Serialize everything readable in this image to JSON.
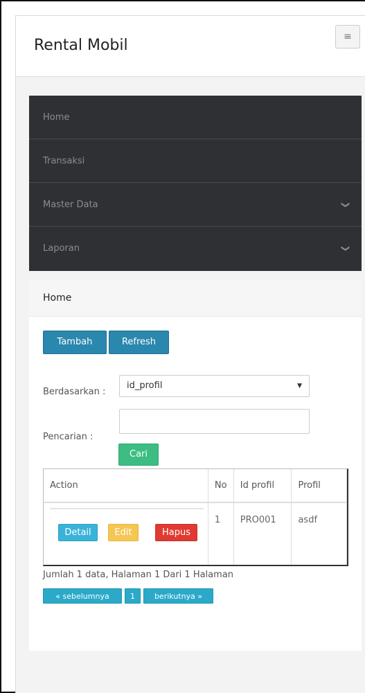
{
  "header": {
    "brand": "Rental Mobil",
    "menu_icon": "hamburger-icon",
    "menu_glyph": "≡"
  },
  "nav": {
    "items": [
      {
        "label": "Home",
        "has_chevron": false
      },
      {
        "label": "Transaksi",
        "has_chevron": false
      },
      {
        "label": "Master Data",
        "has_chevron": true
      },
      {
        "label": "Laporan",
        "has_chevron": true
      }
    ],
    "chevron_glyph": "❯"
  },
  "panel": {
    "title": "Home",
    "add_label": "Tambah",
    "refresh_label": "Refresh",
    "filter_label": "Berdasarkan :",
    "filter_value": "id_profil",
    "filter_arrow": "▼",
    "search_label": "Pencarian   :",
    "search_value": "",
    "search_button": "Cari",
    "table": {
      "headers": [
        "Action",
        "No",
        "Id profil",
        "Profil"
      ],
      "rows": [
        {
          "no": "1",
          "id_profil": "PRO001",
          "profil": "asdf",
          "actions": [
            "Detail",
            "Edit",
            "Hapus"
          ]
        }
      ]
    },
    "summary": "Jumlah 1 data, Halaman 1 Dari 1 Halaman",
    "pagination": {
      "prev": "« sebelumnya",
      "current": "1",
      "next": "berikutnya »"
    }
  },
  "colors": {
    "primary": "#2a87ad",
    "success": "#3dbd83",
    "info": "#3ab3d9",
    "warning": "#f6c653",
    "danger": "#e03b31",
    "nav_bg": "#2f3033"
  }
}
